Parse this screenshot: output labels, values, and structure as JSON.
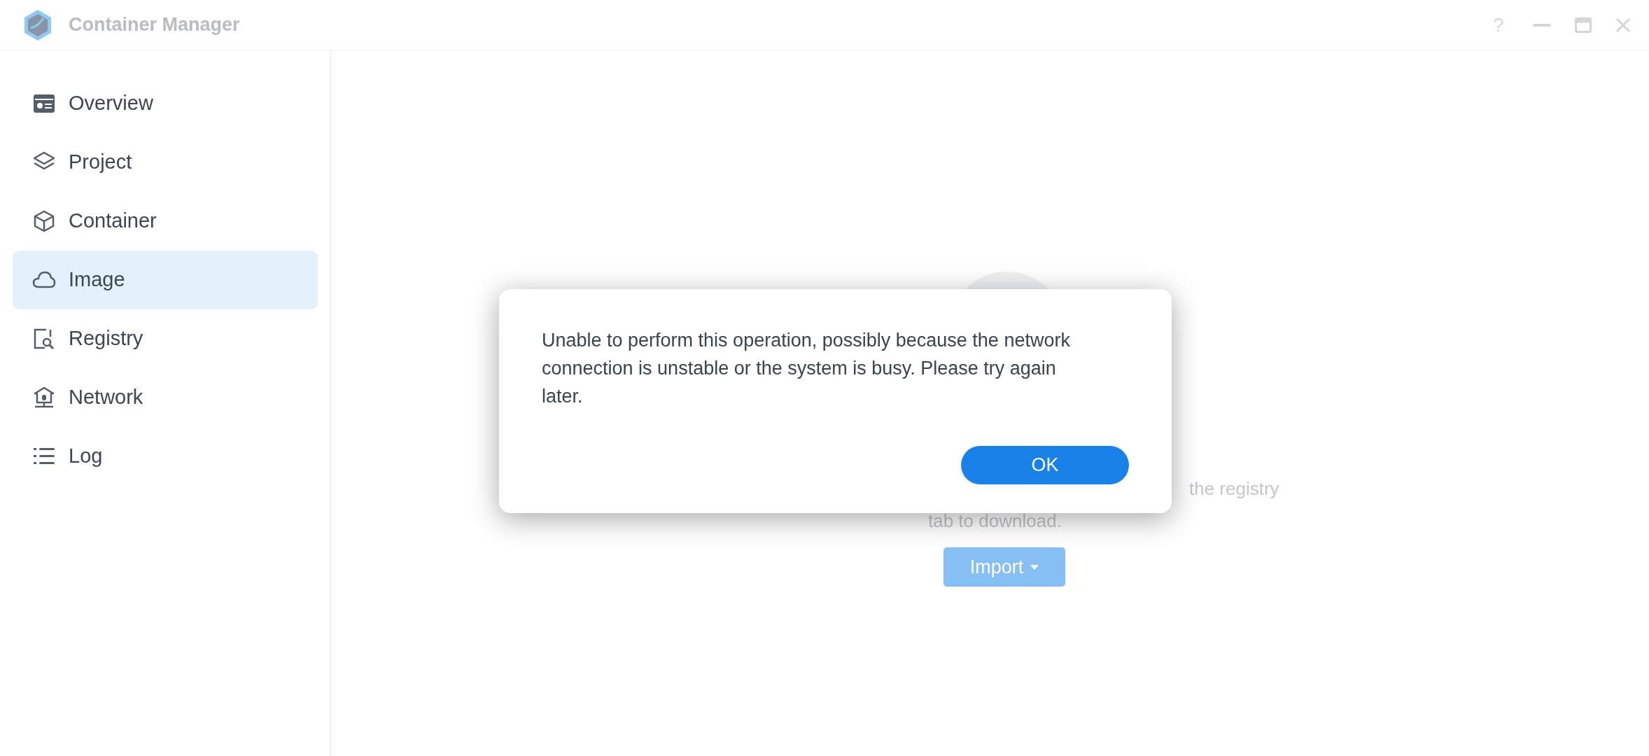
{
  "window": {
    "title": "Container Manager",
    "help_button": "?"
  },
  "sidebar": {
    "items": [
      {
        "label": "Overview",
        "selected": false
      },
      {
        "label": "Project",
        "selected": false
      },
      {
        "label": "Container",
        "selected": false
      },
      {
        "label": "Image",
        "selected": true
      },
      {
        "label": "Registry",
        "selected": false
      },
      {
        "label": "Network",
        "selected": false
      },
      {
        "label": "Log",
        "selected": false
      }
    ]
  },
  "empty_state": {
    "text_line_1": "the registry",
    "text_line_2": "tab to download.",
    "import_button": "Import"
  },
  "dialog": {
    "message": "Unable to perform this operation, possibly because the network connection is unstable or the system is busy. Please try again later.",
    "ok_button": "OK"
  }
}
